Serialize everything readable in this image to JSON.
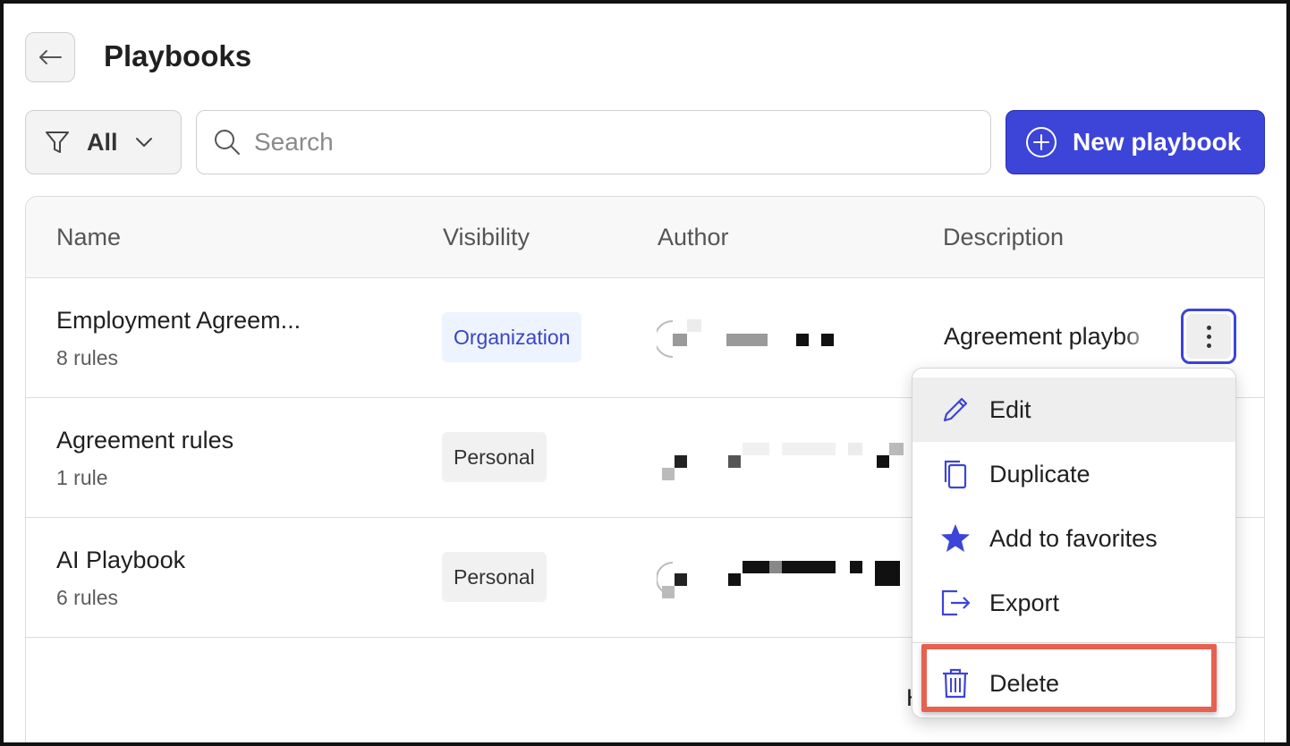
{
  "header": {
    "back_icon": "arrow-left-icon",
    "title": "Playbooks"
  },
  "toolbar": {
    "filter_icon": "funnel-icon",
    "filter_label": "All",
    "search_placeholder": "Search",
    "search_value": "",
    "new_button_label": "New playbook",
    "new_button_icon": "plus-circle-icon",
    "accent_color": "#3d44d8"
  },
  "table": {
    "columns": [
      "Name",
      "Visibility",
      "Author",
      "Description"
    ],
    "rows": [
      {
        "name": "Employment Agreem...",
        "rules": "8 rules",
        "visibility": "Organization",
        "description": "Agreement playbo"
      },
      {
        "name": "Agreement rules",
        "rules": "1 rule",
        "visibility": "Personal",
        "description": ""
      },
      {
        "name": "AI Playbook",
        "rules": "6 rules",
        "visibility": "Personal",
        "description": ""
      }
    ],
    "footer_fragment": "H"
  },
  "context_menu": {
    "items": [
      {
        "label": "Edit",
        "icon": "pencil-icon"
      },
      {
        "label": "Duplicate",
        "icon": "copy-icon"
      },
      {
        "label": "Add to favorites",
        "icon": "star-icon"
      },
      {
        "label": "Export",
        "icon": "export-icon"
      },
      {
        "label": "Delete",
        "icon": "trash-icon"
      }
    ],
    "highlight_color": "#e8604f"
  }
}
